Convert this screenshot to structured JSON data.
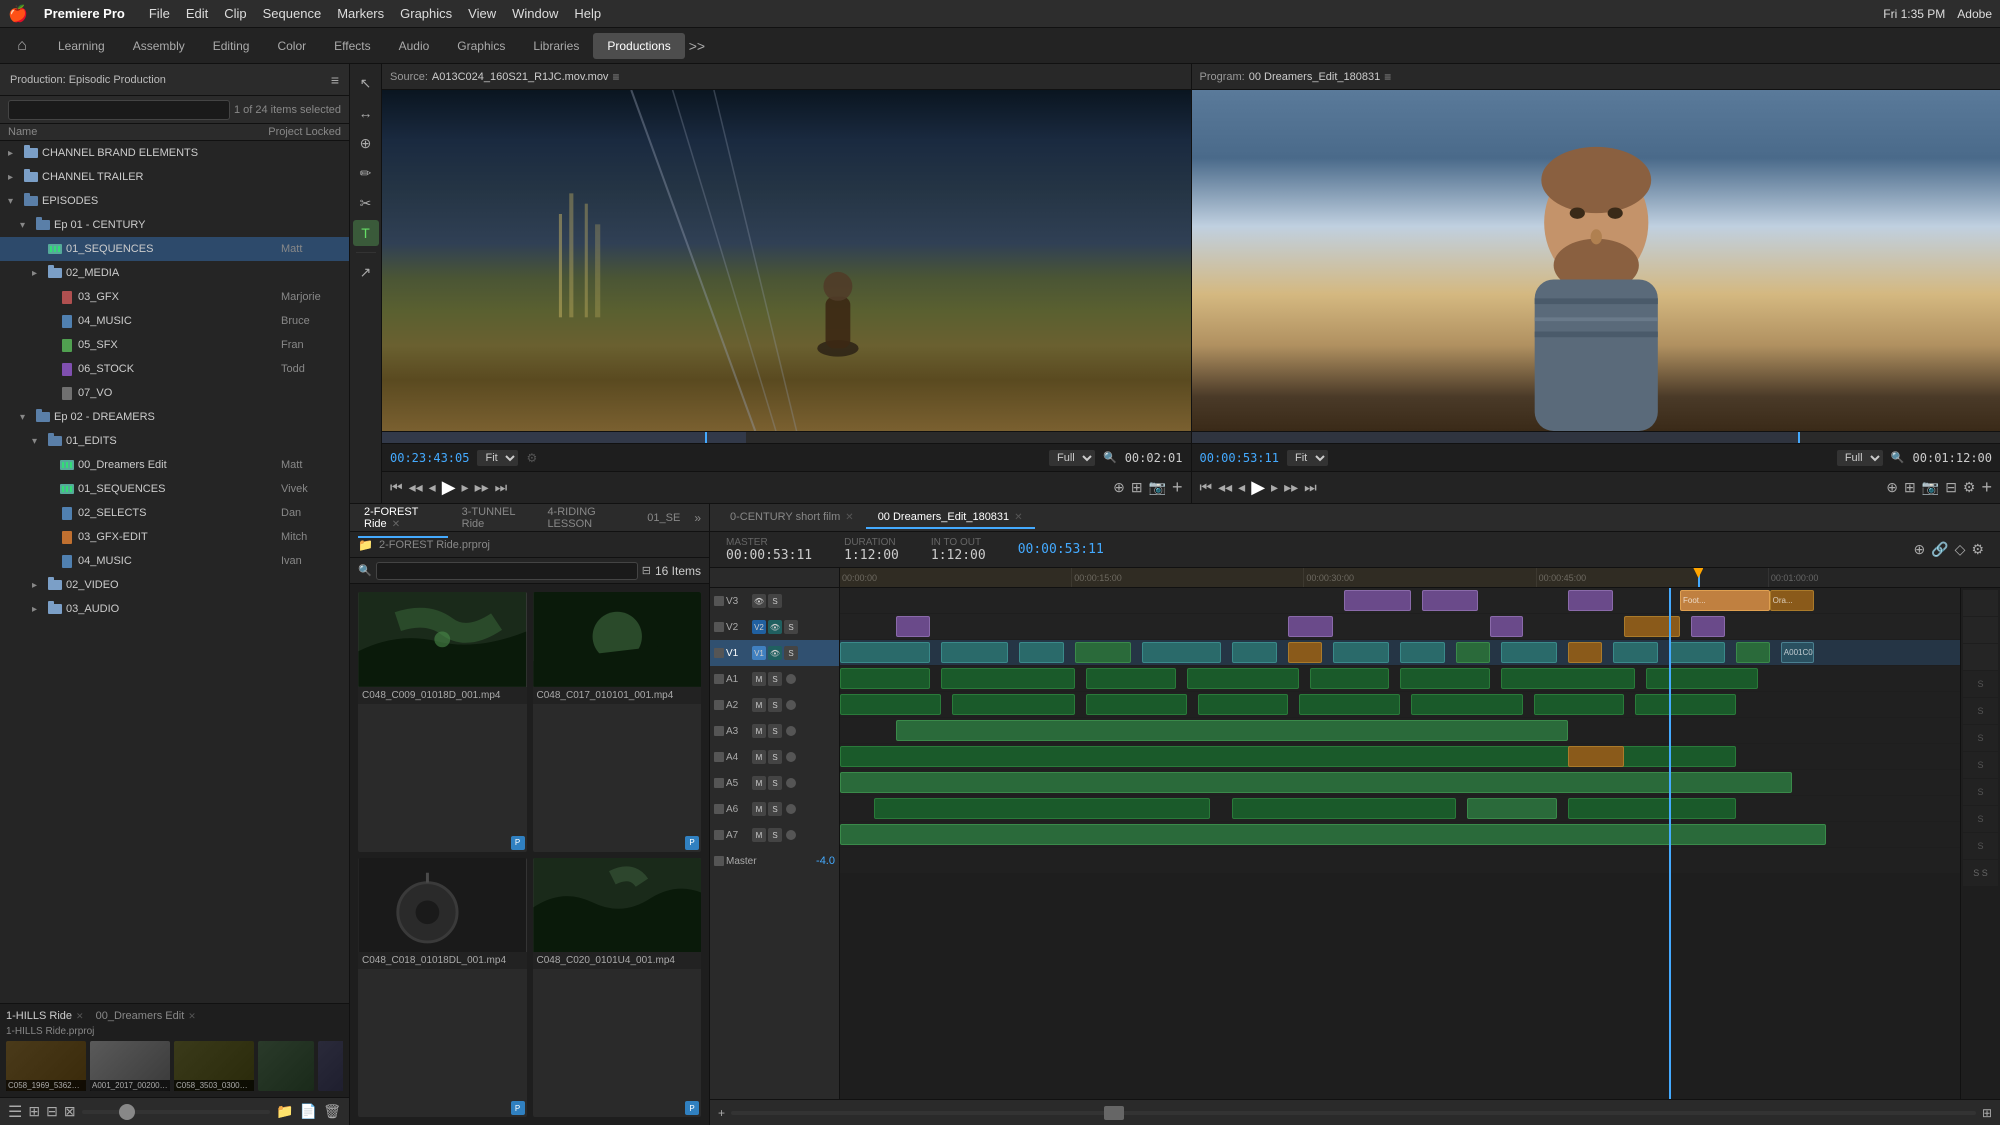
{
  "menubar": {
    "apple": "🍎",
    "appname": "Premiere Pro",
    "menus": [
      "File",
      "Edit",
      "Clip",
      "Sequence",
      "Markers",
      "Graphics",
      "View",
      "Window",
      "Help"
    ],
    "right": [
      "Fri 1:35 PM",
      "Adobe"
    ]
  },
  "workspace_tabs": {
    "tabs": [
      "Learning",
      "Assembly",
      "Editing",
      "Color",
      "Effects",
      "Audio",
      "Graphics",
      "Libraries",
      "Productions"
    ],
    "active": "Productions",
    "more": ">>"
  },
  "left_panel": {
    "title": "Production: Episodic Production",
    "items_count": "1 of 24 items selected",
    "col_name": "Name",
    "col_locked": "Project Locked",
    "search_placeholder": "",
    "tree": [
      {
        "id": 1,
        "depth": 1,
        "type": "folder",
        "name": "CHANNEL BRAND ELEMENTS",
        "arrow": "▸",
        "owner": ""
      },
      {
        "id": 2,
        "depth": 1,
        "type": "folder",
        "name": "CHANNEL TRAILER",
        "arrow": "▸",
        "owner": ""
      },
      {
        "id": 3,
        "depth": 1,
        "type": "folder",
        "name": "EPISODES",
        "arrow": "▾",
        "owner": ""
      },
      {
        "id": 4,
        "depth": 2,
        "type": "folder",
        "name": "Ep 01 - CENTURY",
        "arrow": "▾",
        "owner": ""
      },
      {
        "id": 5,
        "depth": 3,
        "type": "seq",
        "name": "01_SEQUENCES",
        "arrow": "",
        "owner": "Matt",
        "selected": true
      },
      {
        "id": 6,
        "depth": 3,
        "type": "folder",
        "name": "02_MEDIA",
        "arrow": "▸",
        "owner": ""
      },
      {
        "id": 7,
        "depth": 3,
        "type": "file-red",
        "name": "03_GFX",
        "arrow": "",
        "owner": "Marjorie"
      },
      {
        "id": 8,
        "depth": 3,
        "type": "file-blue",
        "name": "04_MUSIC",
        "arrow": "",
        "owner": "Bruce"
      },
      {
        "id": 9,
        "depth": 3,
        "type": "file-green",
        "name": "05_SFX",
        "arrow": "",
        "owner": "Fran"
      },
      {
        "id": 10,
        "depth": 3,
        "type": "file-purple",
        "name": "06_STOCK",
        "arrow": "",
        "owner": "Todd"
      },
      {
        "id": 11,
        "depth": 3,
        "type": "file-gray",
        "name": "07_VO",
        "arrow": "",
        "owner": ""
      },
      {
        "id": 12,
        "depth": 2,
        "type": "folder",
        "name": "Ep 02 - DREAMERS",
        "arrow": "▾",
        "owner": ""
      },
      {
        "id": 13,
        "depth": 3,
        "type": "folder",
        "name": "01_EDITS",
        "arrow": "▾",
        "owner": ""
      },
      {
        "id": 14,
        "depth": 4,
        "type": "seq",
        "name": "00_Dreamers Edit",
        "arrow": "",
        "owner": "Matt"
      },
      {
        "id": 15,
        "depth": 4,
        "type": "seq",
        "name": "01_SEQUENCES",
        "arrow": "",
        "owner": "Vivek"
      },
      {
        "id": 16,
        "depth": 4,
        "type": "file-blue",
        "name": "02_SELECTS",
        "arrow": "",
        "owner": "Dan"
      },
      {
        "id": 17,
        "depth": 4,
        "type": "file-orange",
        "name": "03_GFX-EDIT",
        "arrow": "",
        "owner": "Mitch"
      },
      {
        "id": 18,
        "depth": 4,
        "type": "file-blue",
        "name": "04_MUSIC",
        "arrow": "",
        "owner": "Ivan"
      },
      {
        "id": 19,
        "depth": 3,
        "type": "folder",
        "name": "02_VIDEO",
        "arrow": "▸",
        "owner": ""
      },
      {
        "id": 20,
        "depth": 3,
        "type": "folder",
        "name": "03_AUDIO",
        "arrow": "▸",
        "owner": ""
      }
    ],
    "bottom_tabs": [
      "1-HILLS Ride",
      "00_Dreamers Edit"
    ]
  },
  "source_monitor": {
    "label": "Source:",
    "name": "A013C024_160S21_R1JC.mov.mov",
    "timecode": "00:23:43:05",
    "fit": "Fit",
    "full": "Full",
    "duration": "00:02:01"
  },
  "program_monitor": {
    "label": "Program:",
    "name": "00 Dreamers_Edit_180831",
    "timecode": "00:00:53:11",
    "fit": "Fit",
    "full": "Full",
    "duration": "00:01:12:00"
  },
  "clip_panel": {
    "tabs": [
      {
        "label": "2-FOREST Ride",
        "active": true
      },
      {
        "label": "3-TUNNEL Ride",
        "active": false
      },
      {
        "label": "4-RIDING LESSON",
        "active": false
      },
      {
        "label": "01_SE",
        "active": false
      }
    ],
    "bin_label": "2-FOREST Ride.prproj",
    "items_count": "16 Items",
    "clips": [
      {
        "name": "C048_C009_01018D_001.mp4",
        "thumb": "thumb-1"
      },
      {
        "name": "C048_C017_010101_001.mp4",
        "thumb": "thumb-2"
      },
      {
        "name": "C048_C018_01018DL_001.mp4",
        "thumb": "thumb-3"
      },
      {
        "name": "C048_C020_0101U4_001.mp4",
        "thumb": "thumb-4"
      }
    ]
  },
  "timeline": {
    "tabs": [
      {
        "label": "0-CENTURY short film",
        "active": false
      },
      {
        "label": "00 Dreamers_Edit_180831",
        "active": true
      }
    ],
    "master_label": "MASTER",
    "master_value": "00:00:53:11",
    "duration_label": "DURATION",
    "duration_value": "1:12:00",
    "in_to_out_label": "IN TO OUT",
    "in_to_out_value": "1:12:00",
    "tc_display": "00:00:53:11",
    "ruler_marks": [
      "00:00:00",
      "00:00:15:00",
      "00:00:30:00",
      "00:00:45:00",
      "00:01:00:00"
    ],
    "tracks": [
      {
        "id": "V3",
        "type": "video",
        "label": "V3"
      },
      {
        "id": "V2",
        "type": "video",
        "label": "V2"
      },
      {
        "id": "V1",
        "type": "video",
        "label": "V1"
      },
      {
        "id": "A1",
        "type": "audio",
        "label": "A1"
      },
      {
        "id": "A2",
        "type": "audio",
        "label": "A2"
      },
      {
        "id": "A3",
        "type": "audio",
        "label": "A3"
      },
      {
        "id": "A4",
        "type": "audio",
        "label": "A4"
      },
      {
        "id": "A5",
        "type": "audio",
        "label": "A5"
      },
      {
        "id": "A6",
        "type": "audio",
        "label": "A6"
      },
      {
        "id": "A7",
        "type": "audio",
        "label": "A7"
      },
      {
        "id": "Master",
        "type": "audio",
        "label": "Master"
      }
    ],
    "master_volume": "-4.0"
  },
  "tools": {
    "buttons": [
      "↑",
      "↔",
      "⊕",
      "✏",
      "✂",
      "T",
      "↗"
    ]
  }
}
